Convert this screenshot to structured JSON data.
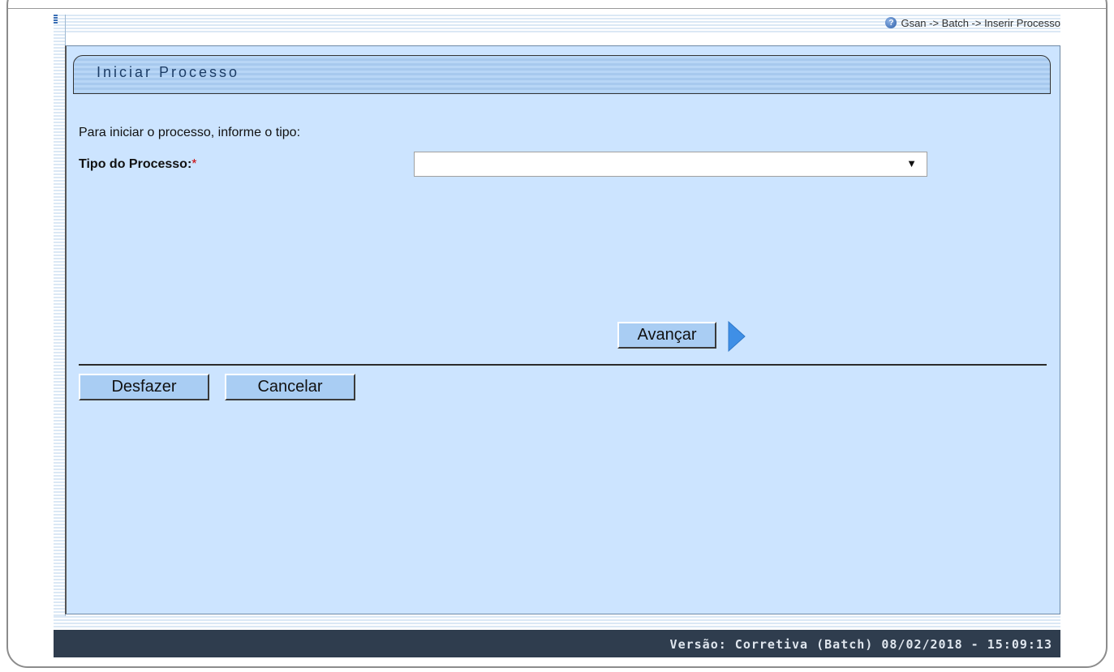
{
  "breadcrumb": {
    "icon": "help-icon",
    "text": "Gsan -> Batch -> Inserir Processo"
  },
  "panel": {
    "title": "Iniciar Processo"
  },
  "form": {
    "instruction": "Para iniciar o processo, informe o tipo:",
    "tipo_label": "Tipo do Processo:",
    "required_mark": "*",
    "tipo_selected": ""
  },
  "buttons": {
    "avancar": "Avançar",
    "desfazer": "Desfazer",
    "cancelar": "Cancelar"
  },
  "footer": {
    "version": "Versão: Corretiva (Batch) 08/02/2018 - 15:09:13"
  },
  "colors": {
    "panel_bg": "#cce4ff",
    "button_bg": "#a9cdf3",
    "footer_bg": "#2f3d4e",
    "required": "#cc0000"
  }
}
